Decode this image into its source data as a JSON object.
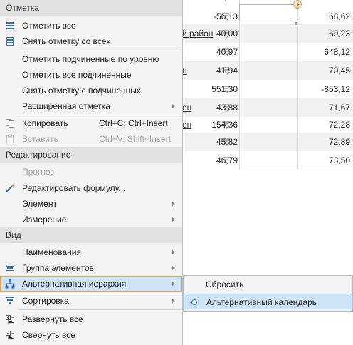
{
  "grid": {
    "rows": [
      {
        "name": "",
        "v1": "",
        "v2": ""
      },
      {
        "name": "",
        "v1": "-56,13",
        "v2": "68,62"
      },
      {
        "name": "й район",
        "v1": "40,00",
        "v2": "69,23"
      },
      {
        "name": "",
        "v1": "40,97",
        "v2": "648,12"
      },
      {
        "name": "н",
        "v1": "41,94",
        "v2": "70,45"
      },
      {
        "name": "",
        "v1": "551,30",
        "v2": "-853,12"
      },
      {
        "name": "он",
        "v1": "43,88",
        "v2": "71,67"
      },
      {
        "name": "он",
        "v1": "154,36",
        "v2": "72,28"
      },
      {
        "name": "",
        "v1": "45,82",
        "v2": "72,89"
      },
      {
        "name": "",
        "v1": "46,79",
        "v2": "73,50"
      }
    ]
  },
  "menu": {
    "section_mark": "Отметка",
    "mark_all": "Отметить все",
    "unmark_all": "Снять отметку со всех",
    "mark_sub_level": "Отметить подчиненные по уровню",
    "mark_all_sub": "Отметить все подчиненные",
    "unmark_sub": "Снять отметку с подчиненных",
    "extended_mark": "Расширенная отметка",
    "copy": "Копировать",
    "copy_shortcut": "Ctrl+C; Ctrl+Insert",
    "paste": "Вставить",
    "paste_shortcut": "Ctrl+V; Shift+Insert",
    "section_edit": "Редактирование",
    "forecast": "Прогноз",
    "edit_formula": "Редактировать формулу...",
    "element": "Элемент",
    "dimension": "Измерение",
    "section_view": "Вид",
    "names": "Наименования",
    "element_group": "Группа элементов",
    "alt_hierarchy": "Альтернативная иерархия",
    "sort": "Сортировка",
    "expand_all": "Развернуть все",
    "collapse_all": "Свернуть все"
  },
  "submenu": {
    "reset": "Сбросить",
    "alt_calendar": "Альтернативный календарь"
  },
  "colors": {
    "menu_bg": "#f3f3f3",
    "header_bg": "#e2e2e2",
    "highlight_bg": "#cfe3f7",
    "highlight_border": "#f0a040",
    "icon_blue": "#3a6fb0"
  }
}
